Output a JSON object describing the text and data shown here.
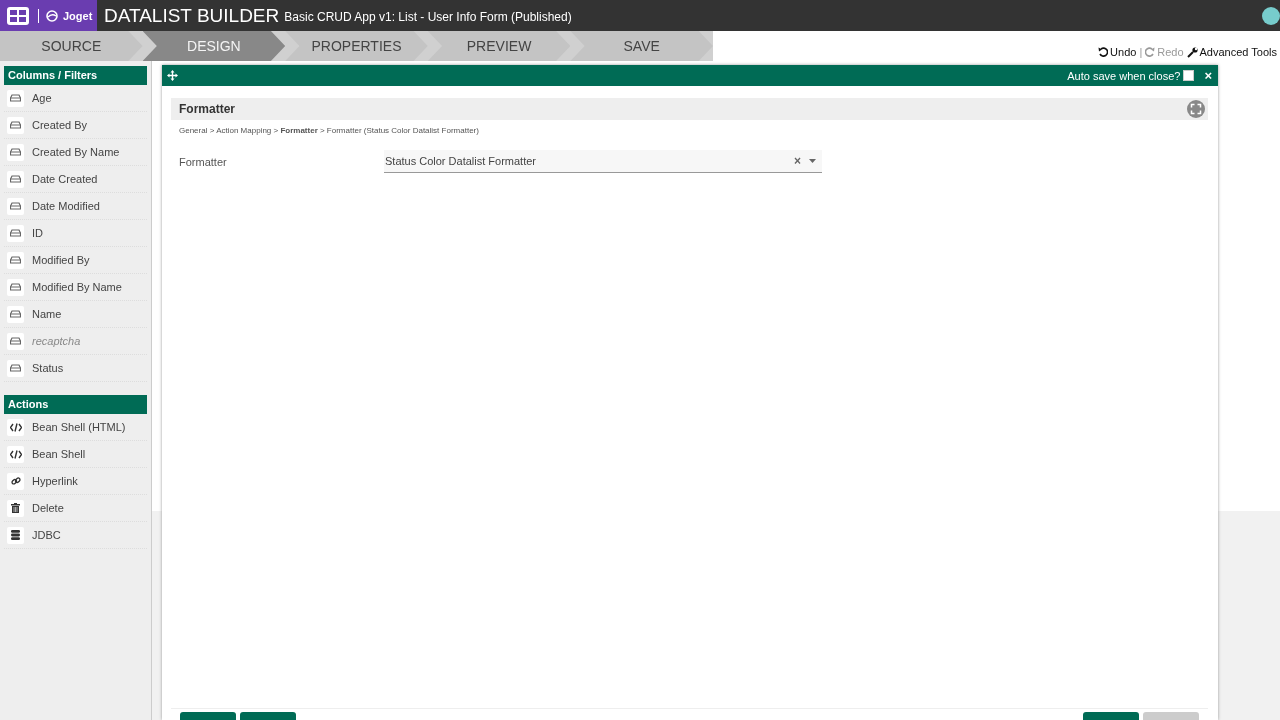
{
  "header": {
    "brand": "Joget",
    "title": "DATALIST BUILDER",
    "subtitle": "Basic CRUD App v1: List - User Info Form (Published)"
  },
  "steps": [
    {
      "label": "SOURCE",
      "selected": false
    },
    {
      "label": "DESIGN",
      "selected": true
    },
    {
      "label": "PROPERTIES",
      "selected": false
    },
    {
      "label": "PREVIEW",
      "selected": false
    },
    {
      "label": "SAVE",
      "selected": false
    }
  ],
  "toolbar": {
    "undo": "Undo",
    "separator": "|",
    "redo": "Redo",
    "redo_disabled": true,
    "advanced": "Advanced Tools"
  },
  "palette": [
    {
      "title": "Columns / Filters",
      "items": [
        {
          "label": "Age",
          "kind": "column",
          "disabled": false
        },
        {
          "label": "Created By",
          "kind": "column",
          "disabled": false
        },
        {
          "label": "Created By Name",
          "kind": "column",
          "disabled": false
        },
        {
          "label": "Date Created",
          "kind": "column",
          "disabled": false
        },
        {
          "label": "Date Modified",
          "kind": "column",
          "disabled": false
        },
        {
          "label": "ID",
          "kind": "column",
          "disabled": false
        },
        {
          "label": "Modified By",
          "kind": "column",
          "disabled": false
        },
        {
          "label": "Modified By Name",
          "kind": "column",
          "disabled": false
        },
        {
          "label": "Name",
          "kind": "column",
          "disabled": false
        },
        {
          "label": "recaptcha",
          "kind": "column",
          "disabled": true
        },
        {
          "label": "Status",
          "kind": "column",
          "disabled": false
        }
      ]
    },
    {
      "title": "Actions",
      "items": [
        {
          "label": "Bean Shell (HTML)",
          "kind": "code",
          "disabled": false
        },
        {
          "label": "Bean Shell",
          "kind": "code",
          "disabled": false
        },
        {
          "label": "Hyperlink",
          "kind": "link",
          "disabled": false
        },
        {
          "label": "Delete",
          "kind": "trash",
          "disabled": false
        },
        {
          "label": "JDBC",
          "kind": "database",
          "disabled": false
        }
      ]
    }
  ],
  "dialog": {
    "autosave_label": "Auto save when close?",
    "autosave_checked": false,
    "close": "×",
    "section_title": "Formatter",
    "breadcrumb": "General > Action Mapping > **Formatter** > Formatter (Status Color Datalist Formatter)",
    "fields": [
      {
        "label": "Formatter",
        "value": "Status Color Datalist Formatter",
        "clear": "×"
      }
    ],
    "footer_left_buttons": [
      {
        "disabled": false
      },
      {
        "disabled": false
      }
    ],
    "footer_right_buttons": [
      {
        "disabled": false
      },
      {
        "disabled": true
      }
    ]
  }
}
